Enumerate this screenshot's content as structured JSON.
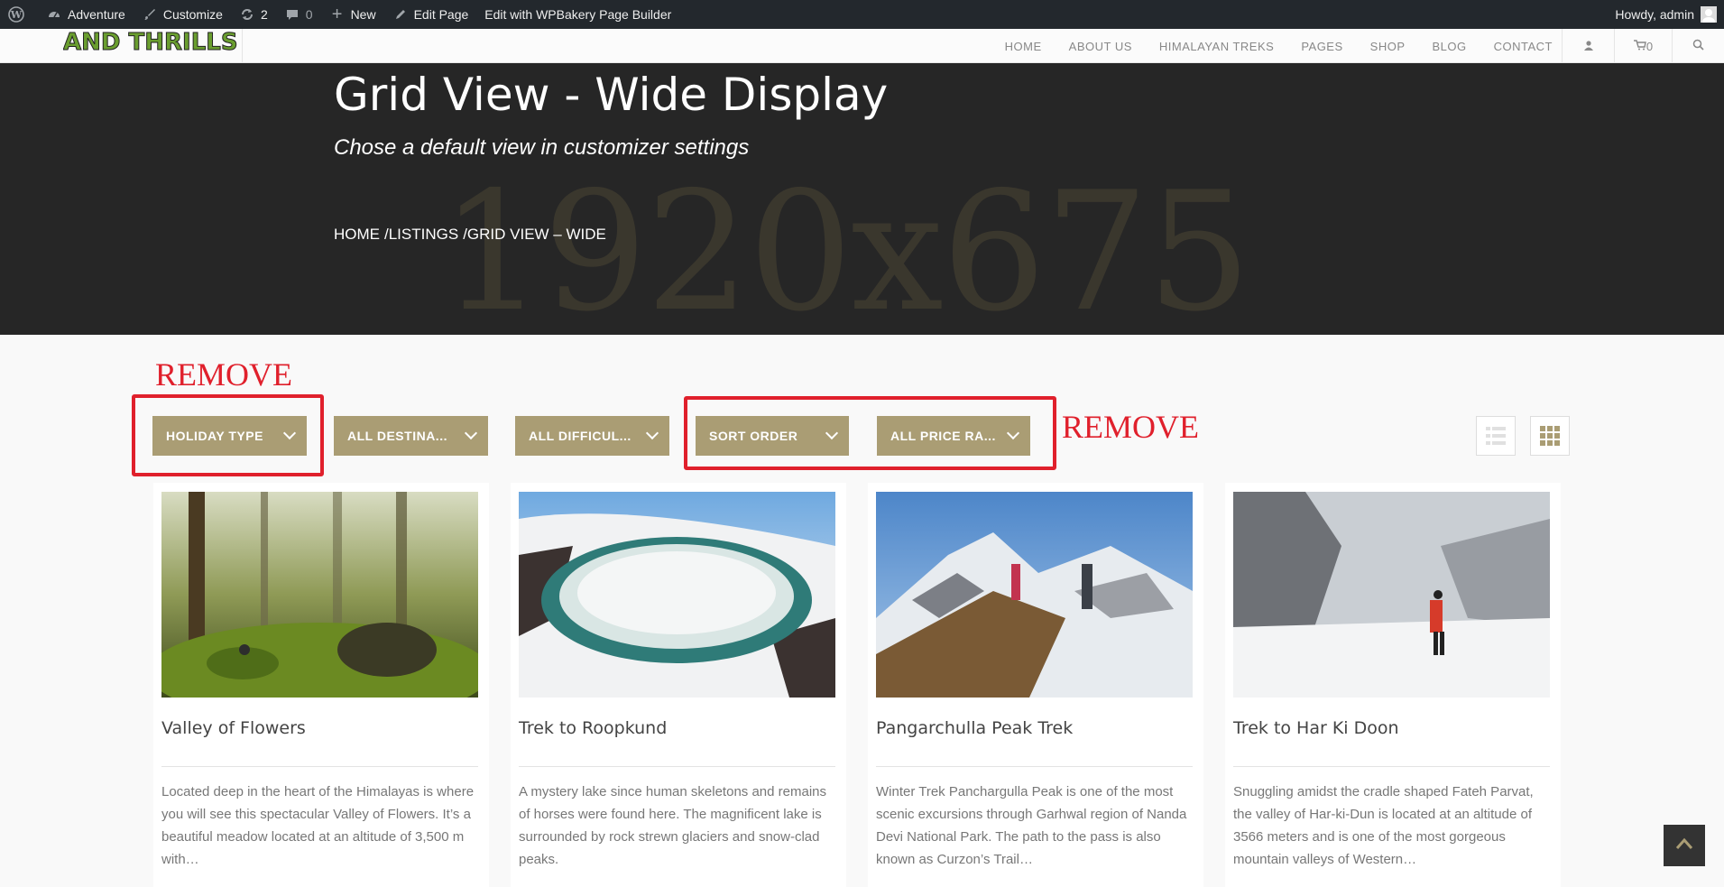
{
  "adminbar": {
    "site_name": "Adventure",
    "customize": "Customize",
    "updates_count": "2",
    "comments_count": "0",
    "new_label": "New",
    "edit_page": "Edit Page",
    "wpbakery": "Edit with WPBakery Page Builder",
    "howdy": "Howdy, admin"
  },
  "header": {
    "logo_text": "AND THRILLS",
    "nav": [
      "HOME",
      "ABOUT US",
      "HIMALAYAN TREKS",
      "PAGES",
      "SHOP",
      "BLOG",
      "CONTACT"
    ],
    "cart_count": "0"
  },
  "hero": {
    "title": "Grid View - Wide Display",
    "subtitle": "Chose a default view in customizer settings",
    "watermark": "1920x675",
    "breadcrumbs": [
      "HOME",
      "/LISTINGS",
      "/GRID VIEW – WIDE"
    ]
  },
  "annotations": {
    "remove_left": "REMOVE",
    "remove_right": "REMOVE",
    "color": "#e0202c"
  },
  "filters": [
    "HOLIDAY TYPE",
    "ALL DESTINA...",
    "ALL DIFFICUL...",
    "SORT ORDER",
    "ALL PRICE RA..."
  ],
  "cards": [
    {
      "title": "Valley of Flowers",
      "desc": "Located deep in the heart of the Himalayas is where you will see this spectacular Valley of Flowers. It’s a beautiful meadow located at an altitude of 3,500 m with…"
    },
    {
      "title": "Trek to Roopkund",
      "desc": "A mystery lake since human skeletons and remains of horses were found here. The magnificent lake is surrounded by rock strewn glaciers and snow-clad peaks."
    },
    {
      "title": "Pangarchulla Peak Trek",
      "desc": "Winter Trek Panchargulla Peak is one of the most scenic excursions through Garhwal region of Nanda Devi National Park. The path to the pass is also known as Curzon’s Trail…"
    },
    {
      "title": "Trek to Har Ki Doon",
      "desc": "Snuggling amidst the cradle shaped Fateh Parvat, the valley of Har-ki-Dun is located at an altitude of 3566 meters and is one of the most gorgeous mountain valleys of Western…"
    }
  ],
  "colors": {
    "filter_bg": "#aa9d74",
    "hero_bg": "#262626",
    "adminbar_bg": "#23282d"
  }
}
